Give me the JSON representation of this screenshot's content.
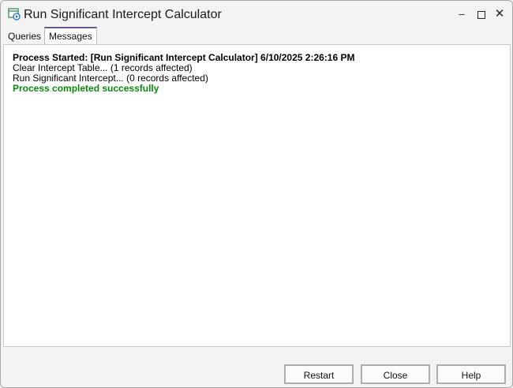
{
  "window": {
    "title": "Run Significant Intercept Calculator",
    "icon": "calculator-run-icon",
    "controls": [
      "minimize",
      "maximize",
      "close"
    ]
  },
  "tabs": [
    {
      "label": "Queries",
      "active": false
    },
    {
      "label": "Messages",
      "active": true
    }
  ],
  "messages": [
    {
      "text": "Process Started: [Run Significant Intercept Calculator] 6/10/2025 2:26:16 PM",
      "style": "bold"
    },
    {
      "text": "Clear Intercept Table... (1 records affected)",
      "style": "normal"
    },
    {
      "text": "Run Significant Intercept... (0 records affected)",
      "style": "normal"
    },
    {
      "text": "Process completed successfully",
      "style": "success"
    }
  ],
  "buttons": {
    "restart": "Restart",
    "close": "Close",
    "help": "Help"
  },
  "colors": {
    "success": "#0a8a0a",
    "tab_accent": "#6b5a8e"
  }
}
